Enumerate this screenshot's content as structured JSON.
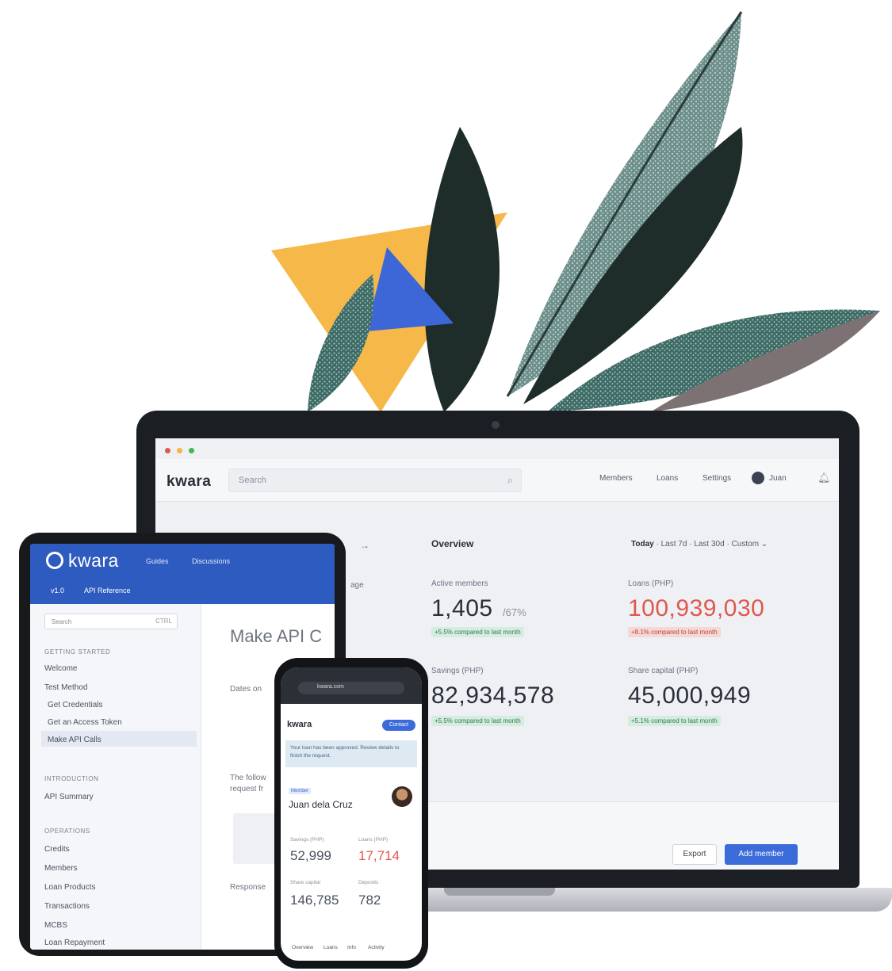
{
  "colors": {
    "accent_blue": "#3a6bd8",
    "header_blue": "#2e5bbf",
    "alert_red": "#e0574f",
    "positive_green": "#2f7d54",
    "leaf_dark": "#1f2d2b",
    "leaf_teal": "#8fb4ad",
    "triangle_yellow": "#f5b84a"
  },
  "laptop": {
    "logo": "kwara",
    "search_placeholder": "Search",
    "search_icon": "search-icon",
    "nav": [
      "Members",
      "Loans",
      "Settings"
    ],
    "user": "Juan",
    "bell_icon": "bell-icon",
    "overview_title": "Overview",
    "filters": {
      "active": "Today",
      "options": [
        "Last 7d",
        "Last 30d",
        "Custom"
      ]
    },
    "stats": [
      {
        "label": "Active members",
        "value": "1,405",
        "sub": "/67%",
        "badge": "+5.5% compared to last month",
        "tone": "green"
      },
      {
        "label": "Loans (PHP)",
        "value": "100,939,030",
        "sub": "",
        "badge": "+8.1% compared to last month",
        "tone": "red"
      },
      {
        "label": "Savings (PHP)",
        "value": "82,934,578",
        "sub": "",
        "badge": "+5.5% compared to last month",
        "tone": "green"
      },
      {
        "label": "Share capital (PHP)",
        "value": "45,000,949",
        "sub": "",
        "badge": "+5.1% compared to last month",
        "tone": "green"
      }
    ],
    "export_label": "Export",
    "add_member_label": "Add member"
  },
  "tablet": {
    "logo": "kwara",
    "nav": [
      "Guides",
      "Discussions"
    ],
    "version": "v1.0",
    "api_reference": "API Reference",
    "search_placeholder": "Search",
    "search_shortcut": "CTRL",
    "sidebar": {
      "section1": "GETTING STARTED",
      "items1": [
        "Welcome",
        "Test Method"
      ],
      "subitems": [
        "Get Credentials",
        "Get an Access Token",
        "Make API Calls"
      ],
      "section2": "INTRODUCTION",
      "items2": [
        "API Summary"
      ],
      "section3": "OPERATIONS",
      "items3": [
        "Credits",
        "Members",
        "Loan Products",
        "Transactions",
        "MCBS",
        "Loan Repayment"
      ]
    },
    "page_title": "Make API C",
    "content_lines": [
      "Dates on",
      "The follow",
      "request fr",
      "Response"
    ]
  },
  "phone": {
    "url": "kwara.com",
    "logo": "kwara",
    "contact_label": "Contact",
    "banner_text": "Your loan has been approved. Review details to finish the request.",
    "tag": "Member",
    "member_name": "Juan dela Cruz",
    "stats": [
      {
        "label": "Savings (PHP)",
        "value": "52,999",
        "tone": "normal"
      },
      {
        "label": "Loans (PHP)",
        "value": "17,714",
        "tone": "red"
      },
      {
        "label": "Share capital",
        "value": "146,785",
        "tone": "normal"
      },
      {
        "label": "Deposits",
        "value": "782",
        "tone": "normal"
      }
    ],
    "tabs": [
      "Overview",
      "Loans",
      "Info",
      "Activity"
    ]
  }
}
